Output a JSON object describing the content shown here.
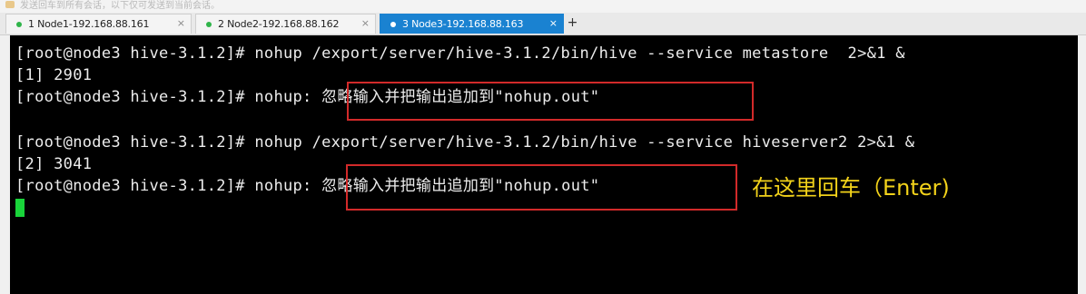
{
  "hint": {
    "text": "发送回车到所有会话，以下仅可发送到当前会话。"
  },
  "tabs": [
    {
      "label": "1 Node1-192.168.88.161",
      "active": false,
      "close": "×"
    },
    {
      "label": "2 Node2-192.168.88.162",
      "active": false,
      "close": "×"
    },
    {
      "label": "3 Node3-192.168.88.163",
      "active": true,
      "close": "×"
    }
  ],
  "add_tab": "+",
  "terminal": {
    "lines": [
      "[root@node3 hive-3.1.2]# nohup /export/server/hive-3.1.2/bin/hive --service metastore  2>&1 &",
      "[1] 2901",
      "[root@node3 hive-3.1.2]# nohup: 忽略输入并把输出追加到\"nohup.out\"",
      "",
      "[root@node3 hive-3.1.2]# nohup /export/server/hive-3.1.2/bin/hive --service hiveserver2 2>&1 &",
      "[2] 3041",
      "[root@node3 hive-3.1.2]# nohup: 忽略输入并把输出追加到\"nohup.out\""
    ]
  },
  "annotation": "在这里回车（Enter)",
  "colors": {
    "terminal_bg": "#000000",
    "terminal_fg": "#ececec",
    "highlight_box": "#d22a2a",
    "annotation": "#f2d21a",
    "cursor": "#19d43a",
    "active_tab": "#1a82d1"
  }
}
